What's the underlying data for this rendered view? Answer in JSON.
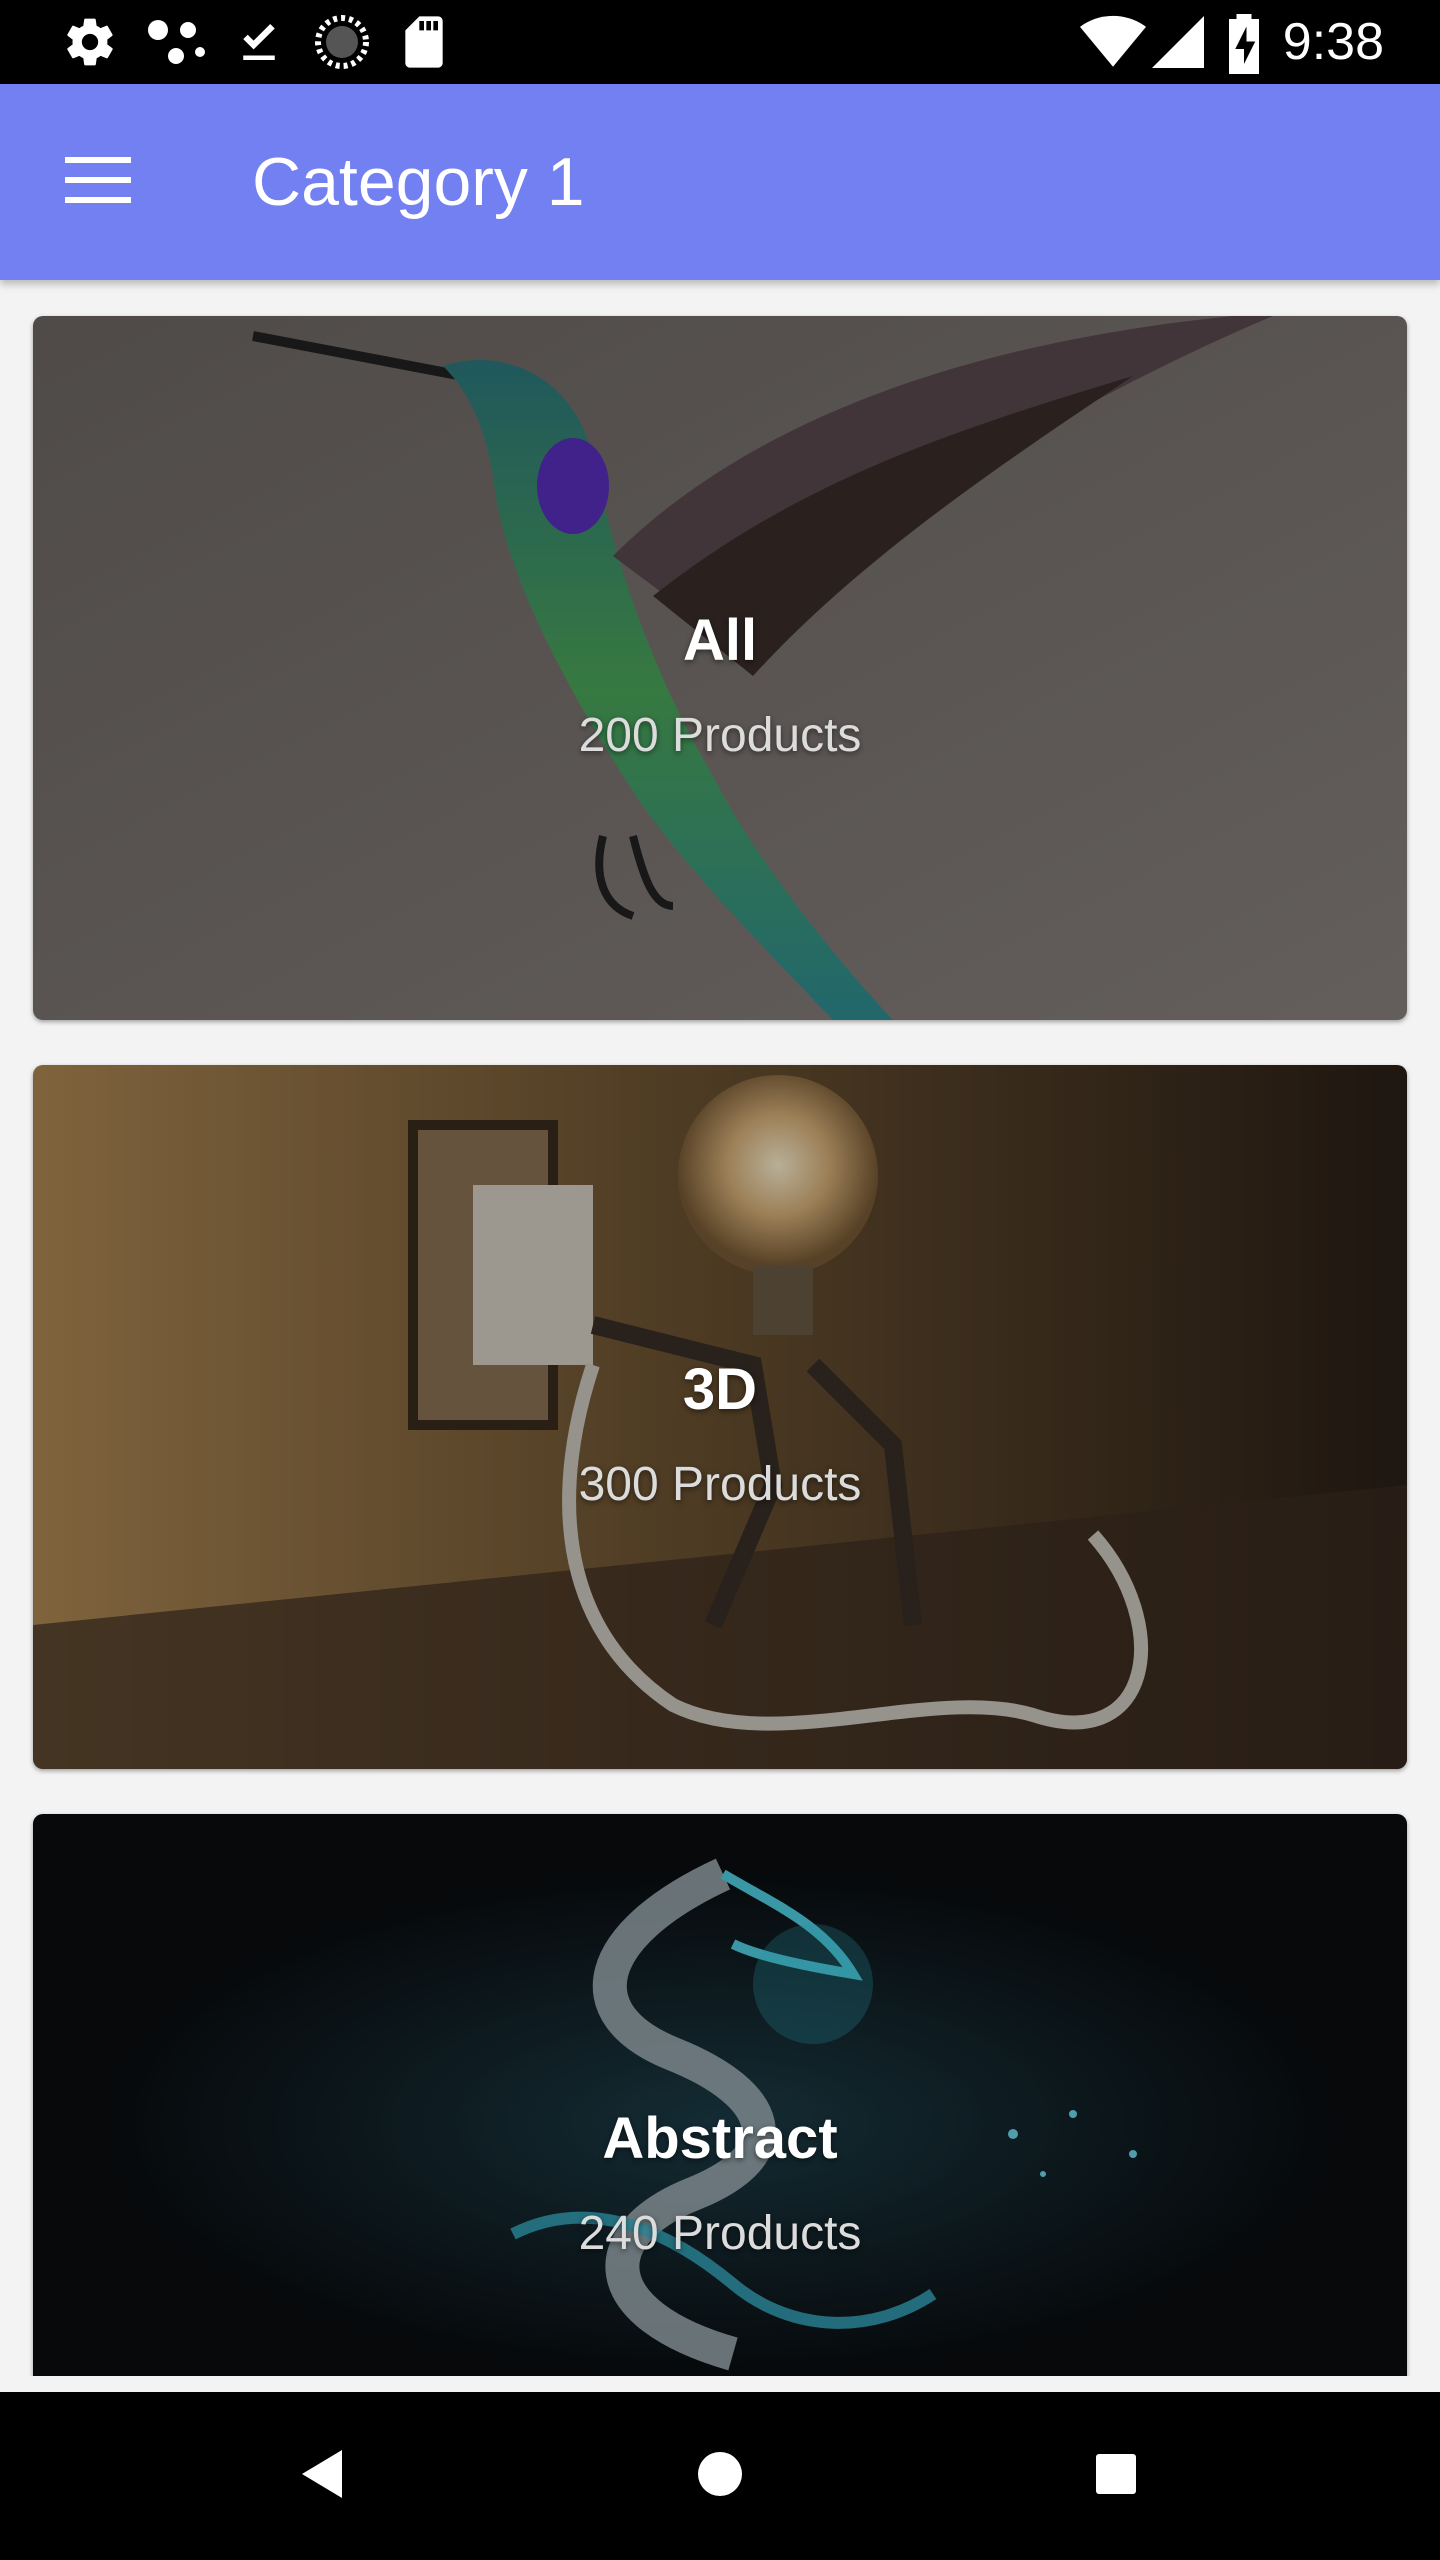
{
  "status_bar": {
    "time": "9:38",
    "left_icons": [
      "gear-icon",
      "dots-icon",
      "download-done-icon",
      "sync-circle-icon",
      "sd-card-icon"
    ],
    "right_icons": [
      "wifi-icon",
      "signal-icon",
      "battery-charging-icon"
    ]
  },
  "app_bar": {
    "menu_icon": "hamburger-icon",
    "title": "Category 1",
    "color": "#7280f2"
  },
  "categories": [
    {
      "title": "All",
      "count": "200 Products",
      "image": "hummingbird"
    },
    {
      "title": "3D",
      "count": "300 Products",
      "image": "lightbulb-robot"
    },
    {
      "title": "Abstract",
      "count": "240 Products",
      "image": "dragon"
    }
  ],
  "nav_bar": {
    "icons": [
      "back-icon",
      "home-icon",
      "recents-icon"
    ]
  }
}
